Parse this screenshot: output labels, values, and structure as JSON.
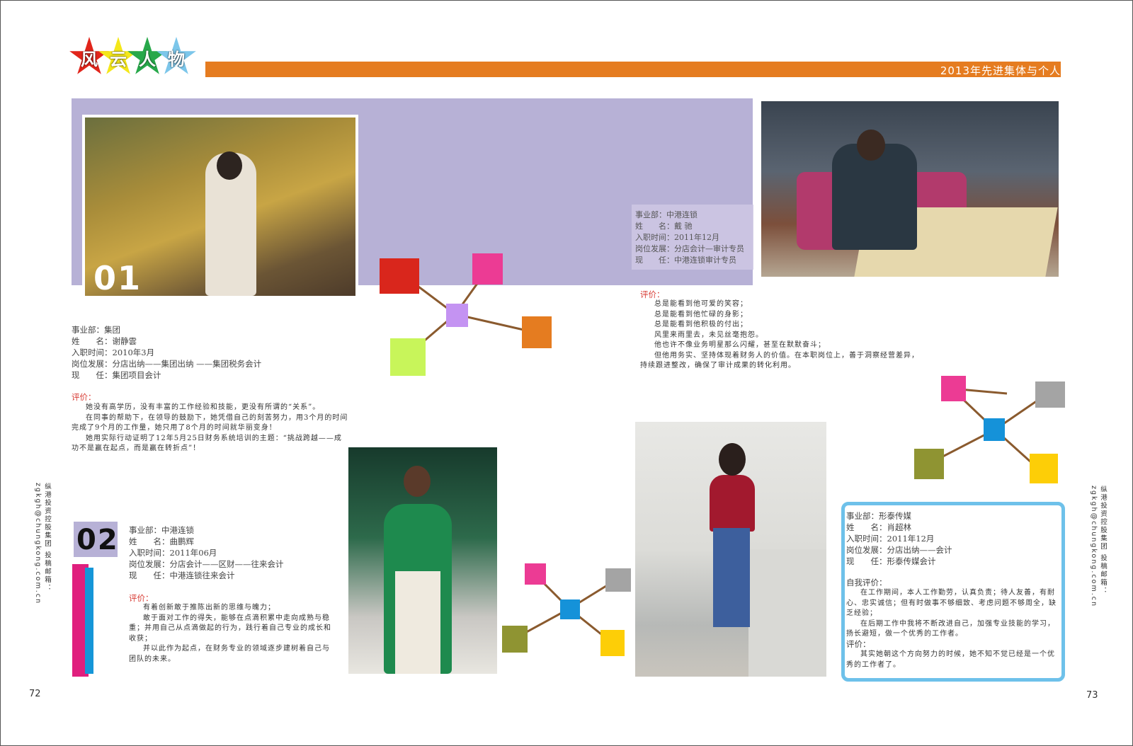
{
  "header": {
    "star_chars": [
      "风",
      "云",
      "人",
      "物"
    ],
    "star_colors": [
      "#e1251b",
      "#f4e71a",
      "#27a84a",
      "#7cc6ea"
    ],
    "title": "2013年先进集体与个人",
    "accent": "#e57c20"
  },
  "person1": {
    "number": "01",
    "lines": [
      "事业部：集团",
      "姓　　名：谢静雲",
      "入职时间：2010年3月",
      "岗位发展：分店出纳——集团出纳 ——集团税务会计",
      "现　　任：集团项目会计"
    ],
    "eval_label": "评价：",
    "eval": [
      "她没有高学历，没有丰富的工作经验和技能，更没有所谓的“关系”。",
      "在同事的帮助下，在领导的鼓励下，她凭借自己的刻苦努力，用3个月的时间完成了9个月的工作量，她只用了8个月的时间就华丽变身！",
      "她用实际行动证明了12年5月25日财务系统培训的主题：“挑战跨越——成功不是赢在起点，而是赢在转折点”！"
    ]
  },
  "person2": {
    "number": "02",
    "lines": [
      "事业部：中港连锁",
      "姓　　名：曲鹏辉",
      "入职时间：2011年06月",
      "岗位发展：分店会计——区财——往来会计",
      "现　　任：中港连锁往来会计"
    ],
    "eval_label": "评价：",
    "eval": [
      "有着创新敢于推陈出新的思维与魄力；",
      "敢于面对工作的得失，能够在点滴积累中走向成熟与稳重；并用自己从点滴做起的行为，践行着自己专业的成长和收获；",
      "并以此作为起点，在财务专业的领域逐步建树着自己与团队的未来。"
    ]
  },
  "person3": {
    "lines": [
      "事业部：中港连锁",
      "姓　　名：戴 驰",
      "入职时间：2011年12月",
      "岗位发展：分店会计—审计专员",
      "现　　任：中港连锁审计专员"
    ],
    "eval_label": "评价：",
    "eval": [
      "总是能看到他可爱的笑容；",
      "总是能看到他忙碌的身影；",
      "总是能看到他积极的付出；",
      "风里来雨里去，未见丝毫抱怨。",
      "他也许不像业务明星那么闪耀，甚至在默默奋斗；",
      "但他用务实、坚持体现着财务人的价值。在本职岗位上，善于洞察经营差异，持续跟进整改，确保了审计成果的转化利用。"
    ]
  },
  "person4": {
    "lines": [
      "事业部：形泰传媒",
      "姓　　名：肖超林",
      "入职时间：2011年12月",
      "岗位发展：分店出纳——会计",
      "现　　任：形泰传媒会计"
    ],
    "self_label": "自我评价：",
    "self_eval": [
      "在工作期间，本人工作勤劳，认真负责；待人友善，有耐心、忠实诚信；但有时做事不够细致、考虑问题不够周全，缺乏经验；",
      "在后期工作中我将不断改进自己，加强专业技能的学习，扬长避短，做一个优秀的工作者。"
    ],
    "eval_label": "评价：",
    "eval": [
      "其实她朝这个方向努力的时候，她不知不觉已经是一个优秀的工作者了。"
    ]
  },
  "sidebar": {
    "left": "纵港投资控股集团 投稿邮箱：zgkgh@chungkong.com.cn",
    "right": "纵港投资控股集团 投稿邮箱：zgkgh@chungkong.com.cn"
  },
  "pages": {
    "left": "72",
    "right": "73"
  },
  "colors": {
    "lavender": "#b7b1d6",
    "red": "#d9261c",
    "pink": "#ec3b94",
    "violet": "#c493f2",
    "orange": "#e57c20",
    "lime": "#c8f55a",
    "blue": "#1592d9",
    "gray": "#a4a4a4",
    "olive": "#8f9432",
    "yellow": "#fdce07",
    "frame_blue": "#6ec1ea",
    "magenta_bar": "#e01f7e",
    "cyan_bar": "#1596d8"
  }
}
